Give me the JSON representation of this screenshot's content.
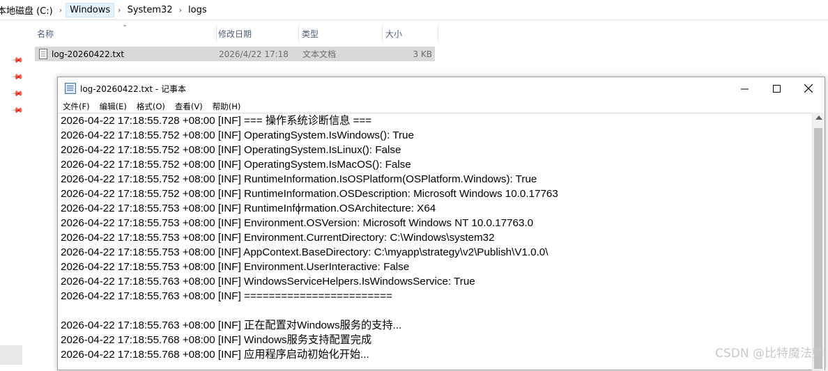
{
  "explorer": {
    "breadcrumb": [
      "本地磁盘 (C:)",
      "Windows",
      "System32",
      "logs"
    ],
    "columns": {
      "name": "名称",
      "date": "修改日期",
      "type": "类型",
      "size": "大小"
    },
    "file": {
      "name": "log-20260422.txt",
      "date": "2026/4/22 17:18",
      "type": "文本文档",
      "size": "3 KB"
    }
  },
  "notepad": {
    "title": "log-20260422.txt - 记事本",
    "menu": [
      "文件(F)",
      "编辑(E)",
      "格式(O)",
      "查看(V)",
      "帮助(H)"
    ],
    "lines": [
      "2026-04-22 17:18:55.728 +08:00 [INF] === 操作系统诊断信息 ===",
      "2026-04-22 17:18:55.752 +08:00 [INF] OperatingSystem.IsWindows(): True",
      "2026-04-22 17:18:55.752 +08:00 [INF] OperatingSystem.IsLinux(): False",
      "2026-04-22 17:18:55.752 +08:00 [INF] OperatingSystem.IsMacOS(): False",
      "2026-04-22 17:18:55.752 +08:00 [INF] RuntimeInformation.IsOSPlatform(OSPlatform.Windows): True",
      "2026-04-22 17:18:55.752 +08:00 [INF] RuntimeInformation.OSDescription: Microsoft Windows 10.0.17763",
      "2026-04-22 17:18:55.753 +08:00 [INF] RuntimeInformation.OSArchitecture: X64",
      "2026-04-22 17:18:55.753 +08:00 [INF] Environment.OSVersion: Microsoft Windows NT 10.0.17763.0",
      "2026-04-22 17:18:55.753 +08:00 [INF] Environment.CurrentDirectory: C:\\Windows\\system32",
      "2026-04-22 17:18:55.753 +08:00 [INF] AppContext.BaseDirectory: C:\\myapp\\strategy\\v2\\Publish\\V1.0.0\\",
      "2026-04-22 17:18:55.753 +08:00 [INF] Environment.UserInteractive: False",
      "2026-04-22 17:18:55.763 +08:00 [INF] WindowsServiceHelpers.IsWindowsService: True",
      "2026-04-22 17:18:55.763 +08:00 [INF] ========================",
      "",
      "2026-04-22 17:18:55.763 +08:00 [INF] 正在配置对Windows服务的支持...",
      "2026-04-22 17:18:55.768 +08:00 [INF] Windows服务支持配置完成",
      "2026-04-22 17:18:55.768 +08:00 [INF] 应用程序启动初始化开始..."
    ]
  },
  "watermark": "CSDN @比特魔法师"
}
